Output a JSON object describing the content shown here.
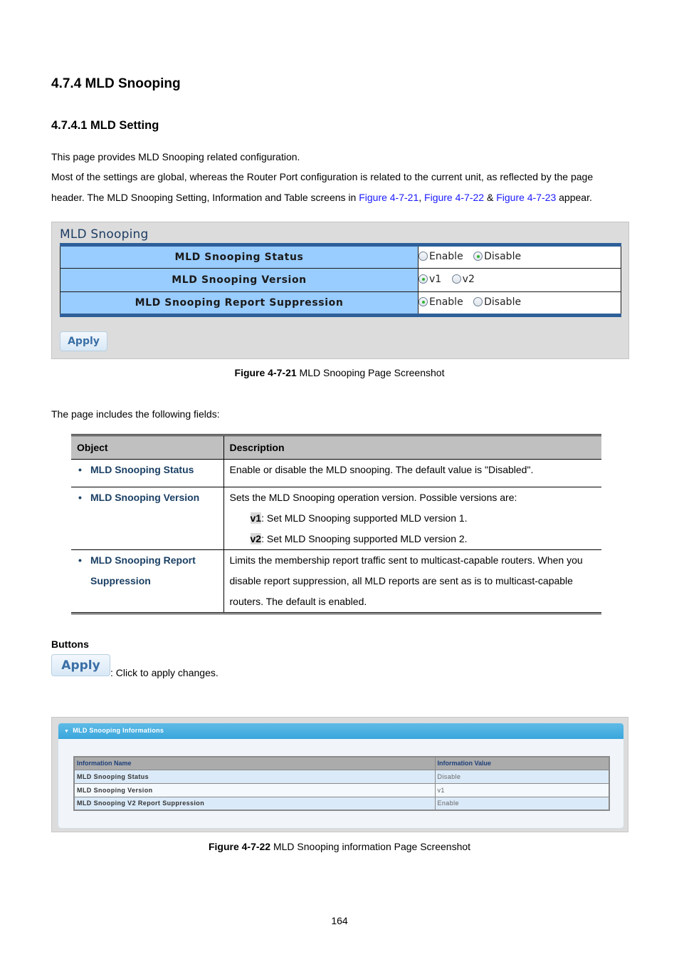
{
  "section": {
    "title": "4.7.4 MLD Snooping",
    "subtitle": "4.7.4.1 MLD Setting"
  },
  "intro": {
    "line1": "This page provides MLD Snooping related configuration.",
    "line2": "Most of the settings are global, whereas the Router Port configuration is related to the current unit, as reflected by the page",
    "line3_pre": "header. The MLD Snooping Setting, Information and Table screens in ",
    "link1": "Figure 4-7-21",
    "sep1": ", ",
    "link2": "Figure 4-7-22",
    "sep2": " & ",
    "link3": "Figure 4-7-23",
    "line3_post": " appear.",
    "link_color": "#1a1aff"
  },
  "figure1": {
    "panel_title": "MLD Snooping",
    "rows": [
      {
        "label": "MLD Snooping Status",
        "options": [
          {
            "label": "Enable",
            "selected": false
          },
          {
            "label": "Disable",
            "selected": true
          }
        ]
      },
      {
        "label": "MLD Snooping Version",
        "options": [
          {
            "label": "v1",
            "selected": true
          },
          {
            "label": "v2",
            "selected": false
          }
        ]
      },
      {
        "label": "MLD Snooping Report Suppression",
        "options": [
          {
            "label": "Enable",
            "selected": true
          },
          {
            "label": "Disable",
            "selected": false
          }
        ]
      }
    ],
    "apply_label": "Apply",
    "caption_bold": "Figure 4-7-21",
    "caption_text": " MLD Snooping Page Screenshot"
  },
  "fields_intro": "The page includes the following fields:",
  "desc_table": {
    "headers": [
      "Object",
      "Description"
    ],
    "rows": [
      {
        "object": "MLD Snooping Status",
        "desc": "Enable or disable the MLD snooping. The default value is \"Disabled\"."
      },
      {
        "object": "MLD Snooping Version",
        "desc": "Sets the MLD Snooping operation version. Possible versions are:",
        "subs": [
          {
            "key": "v1",
            "text": ": Set MLD Snooping supported MLD version 1."
          },
          {
            "key": "v2",
            "text": ": Set MLD Snooping supported MLD version 2."
          }
        ]
      },
      {
        "object_line1": "MLD Snooping Report",
        "object_line2": "Suppression",
        "desc_line1": "Limits the membership report traffic sent to multicast-capable routers. When you",
        "desc_line2": "disable report suppression, all MLD reports are sent as is to multicast-capable",
        "desc_line3": "routers. The default is enabled."
      }
    ]
  },
  "buttons": {
    "heading": "Buttons",
    "apply_label": "Apply",
    "apply_desc": ": Click to apply changes."
  },
  "figure2": {
    "panel_title": "MLD Snooping Informations",
    "headers": [
      "Information Name",
      "Information Value"
    ],
    "rows": [
      {
        "name": "MLD Snooping Status",
        "value": "Disable"
      },
      {
        "name": "MLD Snooping Version",
        "value": "v1"
      },
      {
        "name": "MLD Snooping V2 Report Suppression",
        "value": "Enable"
      }
    ],
    "caption_bold": "Figure 4-7-22",
    "caption_text": " MLD Snooping information Page Screenshot"
  },
  "page_number": "164"
}
